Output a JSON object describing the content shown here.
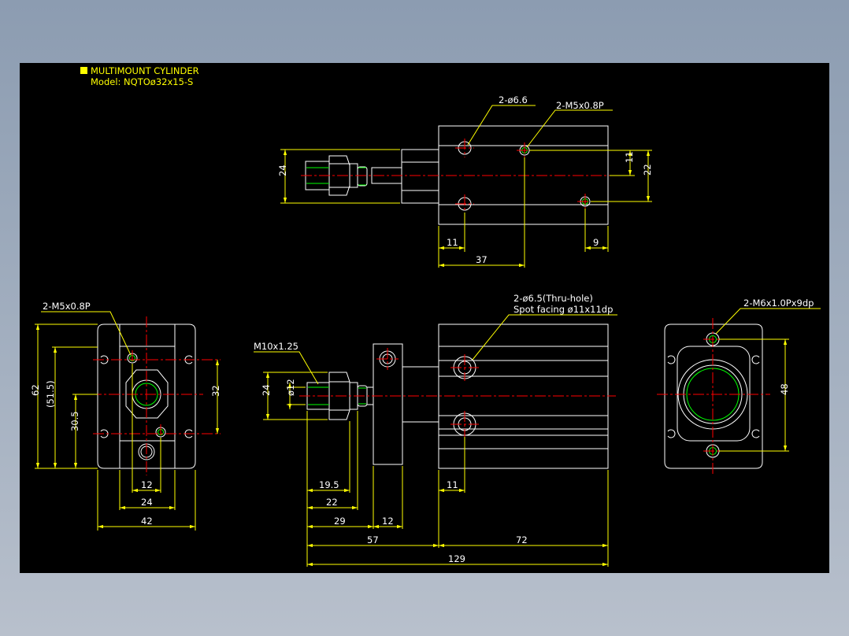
{
  "title": {
    "line1": "MULTIMOUNT CYLINDER",
    "line2": "Model: NQTOø32x15-S"
  },
  "top_view": {
    "note_hole": "2-ø6.6",
    "note_tap": "2-M5x0.8P",
    "dim_height": "24",
    "dim_11_right": "11",
    "dim_22": "22",
    "dim_11_bottom": "11",
    "dim_9": "9",
    "dim_37": "37"
  },
  "left_view": {
    "note_tap": "2-M5x0.8P",
    "dim_62": "62",
    "dim_51_5": "(51.5)",
    "dim_30_5": "30.5",
    "dim_32": "32",
    "dim_12": "12",
    "dim_24": "24",
    "dim_42": "42"
  },
  "front_view": {
    "note_thread": "M10x1.25",
    "note_thru_1": "2-ø6.5(Thru-hole)",
    "note_thru_2": "Spot facing ø11x11dp",
    "dim_24": "24",
    "dim_dia12": "ø12",
    "dim_19_5": "19.5",
    "dim_22": "22",
    "dim_29": "29",
    "dim_12": "12",
    "dim_11": "11",
    "dim_57": "57",
    "dim_72": "72",
    "dim_129": "129"
  },
  "right_view": {
    "note_tap": "2-M6x1.0Px9dp",
    "dim_48": "48"
  },
  "colors": {
    "background": "#000000",
    "outline": "#ffffff",
    "dimension": "#ffff00",
    "centerline": "#ff0000",
    "green": "#00ff00"
  }
}
